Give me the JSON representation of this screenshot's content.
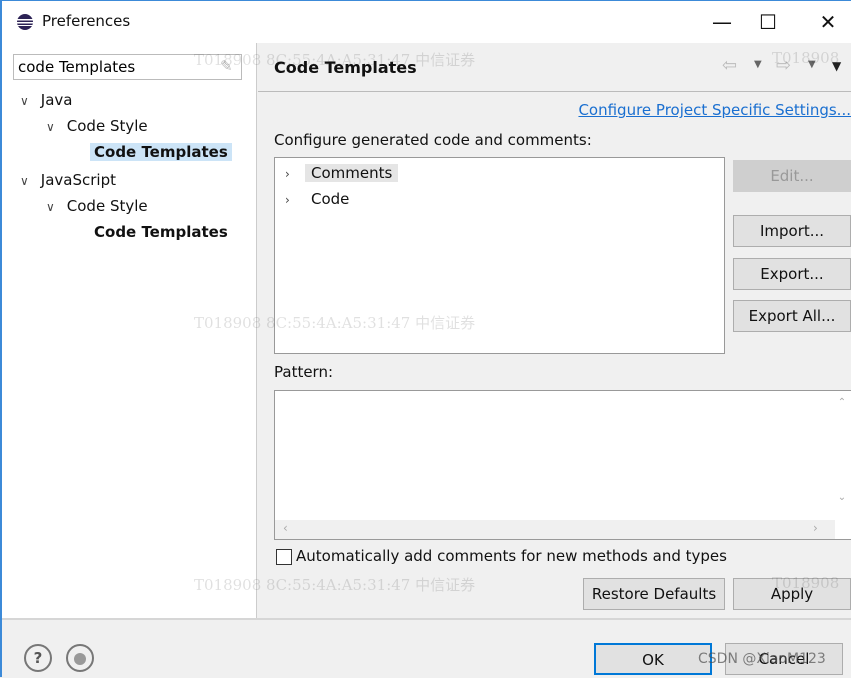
{
  "window": {
    "title": "Preferences",
    "minimize": "—",
    "maximize": "☐",
    "close": "✕"
  },
  "sidebar": {
    "search_value": "code Templates",
    "items": [
      {
        "label": "Java"
      },
      {
        "label": "Code Style"
      },
      {
        "label": "Code Templates"
      },
      {
        "label": "JavaScript"
      },
      {
        "label": "Code Style"
      },
      {
        "label": "Code Templates"
      }
    ]
  },
  "main": {
    "title": "Code Templates",
    "link": "Configure Project Specific Settings...",
    "list_label": "Configure generated code and comments:",
    "list_items": [
      "Comments",
      "Code"
    ],
    "buttons": {
      "edit": "Edit...",
      "import": "Import...",
      "export": "Export...",
      "export_all": "Export All..."
    },
    "pattern_label": "Pattern:",
    "checkbox_label": "Automatically add comments for new methods and types",
    "checkbox_checked": false,
    "restore_defaults": "Restore Defaults",
    "apply": "Apply"
  },
  "footer": {
    "ok": "OK",
    "cancel": "Cancel"
  },
  "watermark": {
    "text": "T018908   8C:55:4A:A5:31:47   中信证券",
    "short": "T018908",
    "csdn": "CSDN @XiaoM123"
  }
}
